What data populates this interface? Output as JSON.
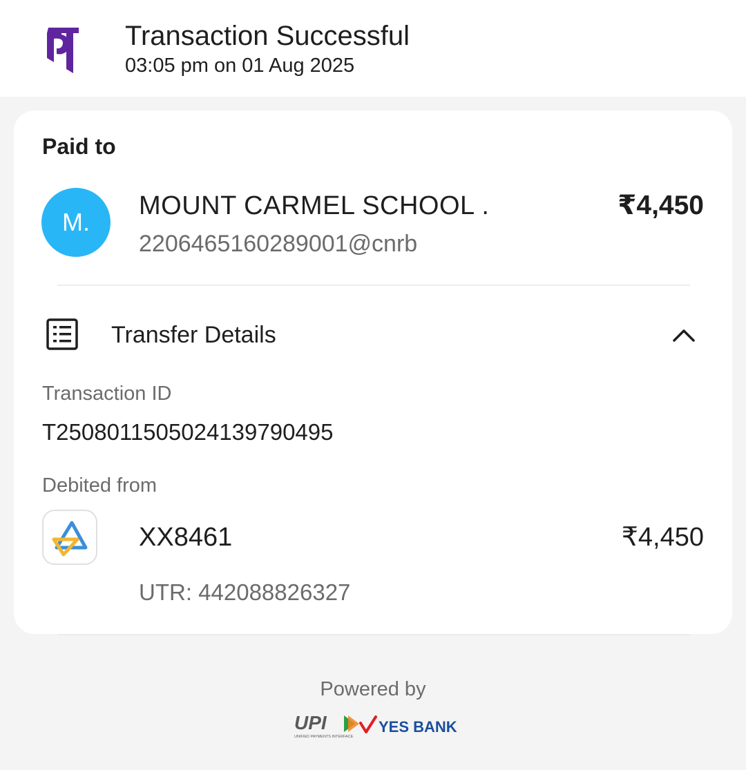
{
  "header": {
    "title": "Transaction Successful",
    "datetime": "03:05 pm on 01 Aug 2025"
  },
  "payment": {
    "paid_to_label": "Paid to",
    "avatar_initial": "M.",
    "payee_name": "MOUNT CARMEL SCHOOL .",
    "payee_upi": "220646516028 9001@cnrb",
    "amount": "₹4,450"
  },
  "transfer": {
    "section_label": "Transfer Details",
    "transaction_id_label": "Transaction ID",
    "transaction_id": "T2508011505024139790495",
    "debited_from_label": "Debited from",
    "account": "XX8461",
    "debit_amount": "₹4,450",
    "utr": "UTR: 442088826327"
  },
  "footer": {
    "powered_by": "Powered by",
    "upi_text": "UPI",
    "upi_subtext": "UNIFIED PAYMENTS INTERFACE",
    "bank_name": "YES BANK"
  },
  "colors": {
    "brand_purple": "#5f259f",
    "avatar_blue": "#29b6f6",
    "yes_bank_blue": "#1a4f9c",
    "yes_bank_red": "#e31e24"
  },
  "icons": {
    "header_logo": "phonepe-logo",
    "details": "receipt-list-icon",
    "collapse": "chevron-up-icon",
    "bank": "sbi-bank-logo"
  }
}
